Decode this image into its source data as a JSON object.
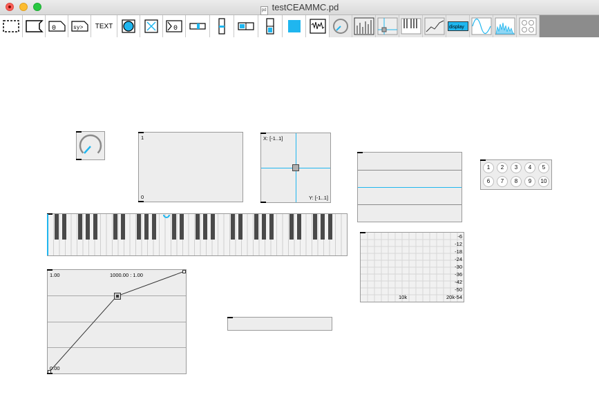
{
  "window": {
    "title": "testCEAMMC.pd"
  },
  "toolbar": {
    "items": [
      {
        "name": "object-tool-button"
      },
      {
        "name": "message-tool-button"
      },
      {
        "name": "number-tool-button",
        "label": "0"
      },
      {
        "name": "symbol-tool-button",
        "label": "sy>"
      },
      {
        "name": "comment-tool-button",
        "label": "TEXT"
      },
      {
        "name": "bang-tool-button"
      },
      {
        "name": "toggle-tool-button"
      },
      {
        "name": "number2-tool-button",
        "label": "0"
      },
      {
        "name": "hslider-tool-button"
      },
      {
        "name": "vslider-tool-button"
      },
      {
        "name": "hradio-tool-button"
      },
      {
        "name": "vradio-tool-button"
      },
      {
        "name": "canvas-tool-button"
      },
      {
        "name": "array-tool-button"
      },
      {
        "name": "knob-tool-button"
      },
      {
        "name": "sliders-tool-button"
      },
      {
        "name": "slider2d-tool-button"
      },
      {
        "name": "keyboard-tool-button"
      },
      {
        "name": "breakpoint-tool-button"
      },
      {
        "name": "display-tool-button",
        "label": "display"
      },
      {
        "name": "scope-tool-button"
      },
      {
        "name": "spectroscope-tool-button"
      },
      {
        "name": "matrix-tool-button"
      }
    ]
  },
  "canvas": {
    "multislider": {
      "top_label": "1",
      "bottom_label": "0"
    },
    "slider2d": {
      "x_label": "X: [-1..1]",
      "y_label": "Y: [-1..1]"
    },
    "button_grid": {
      "labels": [
        "1",
        "2",
        "3",
        "4",
        "5",
        "6",
        "7",
        "8",
        "9",
        "10"
      ]
    },
    "spectroscope": {
      "db_labels": [
        "-6",
        "-12",
        "-18",
        "-24",
        "-30",
        "-36",
        "-42",
        "-50"
      ],
      "bottom_db": "-54",
      "freq_labels": [
        "10k",
        "20k"
      ]
    },
    "breakpoints": {
      "top_left": "1.00",
      "readout": "1000.00 : 1.00",
      "bottom_left": "0.00"
    }
  }
}
